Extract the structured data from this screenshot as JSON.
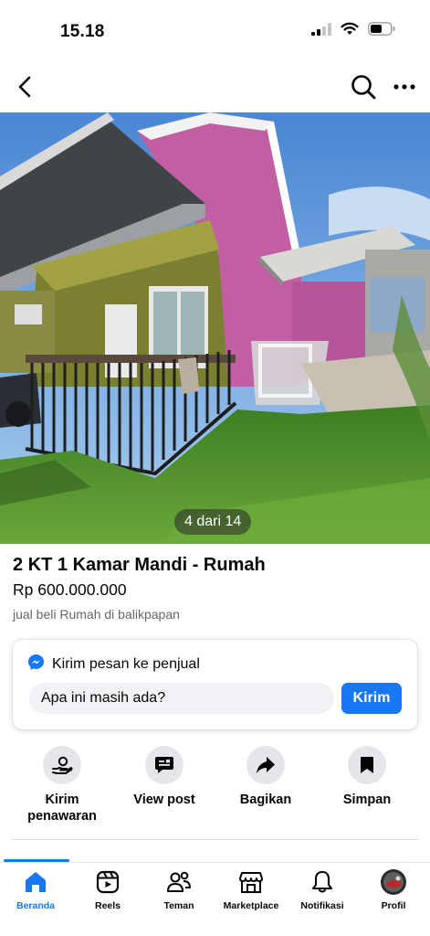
{
  "status": {
    "time": "15.18",
    "battery_percent": 60
  },
  "nav": {
    "back_icon": "chevron-left-icon",
    "search_icon": "search-icon",
    "more_icon": "more-horizontal-icon"
  },
  "photo": {
    "counter": "4 dari 14",
    "current_index": 4,
    "total": 14
  },
  "listing": {
    "title": "2 KT 1 Kamar Mandi - Rumah",
    "price": "Rp 600.000.000",
    "location": "jual beli Rumah di balikpapan"
  },
  "message": {
    "heading": "Kirim pesan ke penjual",
    "input_value": "Apa ini masih ada?",
    "send_label": "Kirim",
    "accent": "#1877f2"
  },
  "actions": [
    {
      "label": "Kirim penawaran",
      "icon": "offer-hand-icon"
    },
    {
      "label": "View post",
      "icon": "post-message-icon"
    },
    {
      "label": "Bagikan",
      "icon": "share-arrow-icon"
    },
    {
      "label": "Simpan",
      "icon": "bookmark-icon"
    }
  ],
  "tabs": [
    {
      "label": "Beranda",
      "icon": "home-icon",
      "active": true
    },
    {
      "label": "Reels",
      "icon": "reels-icon",
      "active": false
    },
    {
      "label": "Teman",
      "icon": "friends-icon",
      "active": false
    },
    {
      "label": "Marketplace",
      "icon": "marketplace-icon",
      "active": false
    },
    {
      "label": "Notifikasi",
      "icon": "bell-icon",
      "active": false
    },
    {
      "label": "Profil",
      "icon": "profile-avatar-icon",
      "active": false
    }
  ]
}
